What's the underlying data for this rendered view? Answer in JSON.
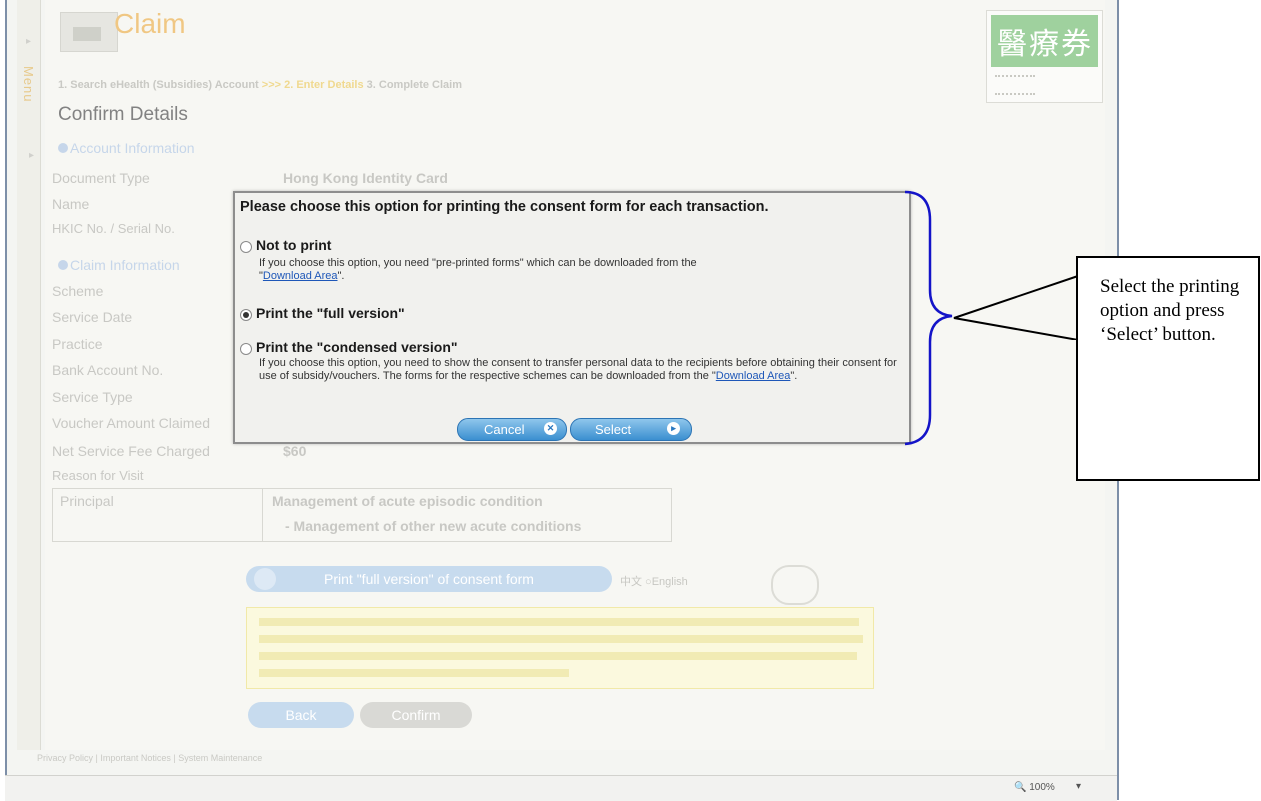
{
  "app": {
    "title": "Claim",
    "menu_label": "Menu",
    "badge_text": "醫療券",
    "steps": [
      "1. Search eHealth (Subsidies) Account",
      "2. Enter Details",
      "3. Complete Claim"
    ],
    "page_title": "Confirm Details"
  },
  "account": {
    "section": "Account Information",
    "document_type_label": "Document Type",
    "document_type_value": "Hong Kong Identity Card",
    "name_label": "Name",
    "hkic_label": "HKIC No. / Serial No."
  },
  "claim": {
    "section": "Claim Information",
    "fields": [
      "Scheme",
      "Service Date",
      "Practice",
      "Bank Account No.",
      "Service Type",
      "Voucher Amount Claimed",
      "Net Service Fee Charged",
      "Reason for Visit"
    ],
    "net_fee_value": "$60",
    "reason_type": "Principal",
    "reason_main": "Management of acute episodic condition",
    "reason_sub": "- Management of other new acute conditions"
  },
  "background_buttons": {
    "print_full": "Print \"full version\" of consent form",
    "lang_options": "中文 ○English",
    "back": "Back",
    "confirm": "Confirm"
  },
  "footer": {
    "links": "Privacy Policy | Important Notices | System Maintenance",
    "zoom": "100%"
  },
  "dialog": {
    "title": "Please choose this option for printing the consent form for each transaction.",
    "options": [
      {
        "label": "Not to print",
        "desc": "If you choose this option, you need \"pre-printed forms\" which can be downloaded from the",
        "link": "Download Area",
        "selected": false
      },
      {
        "label": "Print the \"full version\"",
        "selected": true
      },
      {
        "label": "Print the \"condensed version\"",
        "desc": "If you choose this option, you need to show the consent to transfer personal data to the recipients before obtaining their consent for use of subsidy/vouchers. The forms for the respective schemes can be downloaded from the",
        "link": "Download Area",
        "selected": false
      }
    ],
    "cancel_label": "Cancel",
    "select_label": "Select"
  },
  "annotation": {
    "text": "Select the printing option and press ‘Select’ button.",
    "brace_color": "#1414c8"
  }
}
